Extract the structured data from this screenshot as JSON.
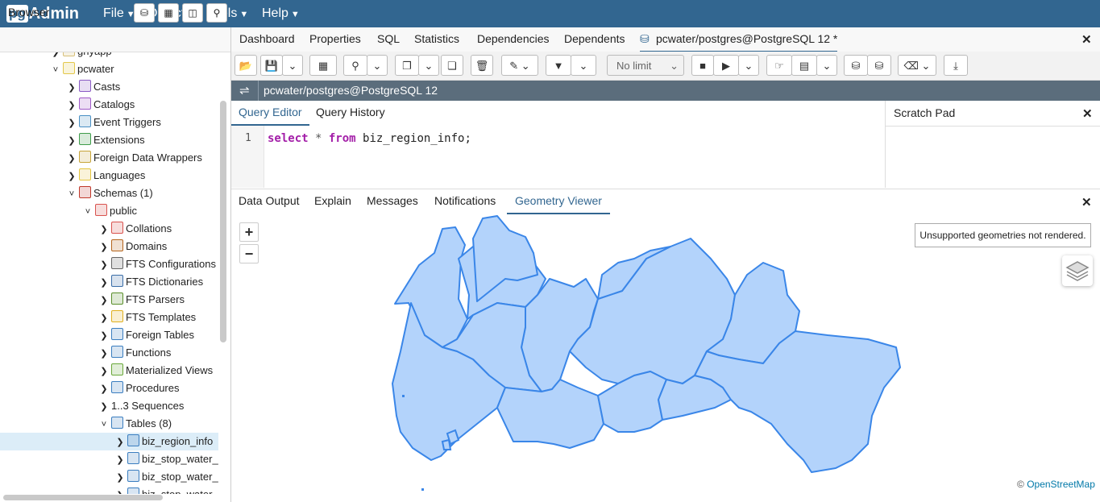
{
  "app": {
    "logo_pg": "pg",
    "logo_admin": "Admin"
  },
  "menu": [
    {
      "label": "File"
    },
    {
      "label": "Object"
    },
    {
      "label": "Tools"
    },
    {
      "label": "Help"
    }
  ],
  "browser": {
    "title": "Browser",
    "tree": [
      {
        "label": "gnyapp",
        "level": 3,
        "arrow": "›",
        "icon_color": "#d7c07a"
      },
      {
        "label": "pcwater",
        "level": 3,
        "arrow": "⌄",
        "icon_color": "#e3c84b"
      },
      {
        "label": "Casts",
        "level": 4,
        "arrow": "›",
        "icon_color": "#8a5cc4"
      },
      {
        "label": "Catalogs",
        "level": 4,
        "arrow": "›",
        "icon_color": "#a05bc8"
      },
      {
        "label": "Event Triggers",
        "level": 4,
        "arrow": "›",
        "icon_color": "#4a90c4"
      },
      {
        "label": "Extensions",
        "level": 4,
        "arrow": "›",
        "icon_color": "#3f9c4a"
      },
      {
        "label": "Foreign Data Wrappers",
        "level": 4,
        "arrow": "›",
        "icon_color": "#c7a53a"
      },
      {
        "label": "Languages",
        "level": 4,
        "arrow": "›",
        "icon_color": "#e4c540"
      },
      {
        "label": "Schemas (1)",
        "level": 4,
        "arrow": "⌄",
        "icon_color": "#c0392b"
      },
      {
        "label": "public",
        "level": 5,
        "arrow": "⌄",
        "icon_color": "#d9534f"
      },
      {
        "label": "Collations",
        "level": 6,
        "arrow": "›",
        "icon_color": "#d9534f"
      },
      {
        "label": "Domains",
        "level": 6,
        "arrow": "›",
        "icon_color": "#b5651d"
      },
      {
        "label": "FTS Configurations",
        "level": 6,
        "arrow": "›",
        "icon_color": "#666666"
      },
      {
        "label": "FTS Dictionaries",
        "level": 6,
        "arrow": "›",
        "icon_color": "#3b6ea8"
      },
      {
        "label": "FTS Parsers",
        "level": 6,
        "arrow": "›",
        "icon_color": "#5a8f2c"
      },
      {
        "label": "FTS Templates",
        "level": 6,
        "arrow": "›",
        "icon_color": "#e0b020"
      },
      {
        "label": "Foreign Tables",
        "level": 6,
        "arrow": "›",
        "icon_color": "#3b7ec0"
      },
      {
        "label": "Functions",
        "level": 6,
        "arrow": "›",
        "icon_color": "#3b7ec0"
      },
      {
        "label": "Materialized Views",
        "level": 6,
        "arrow": "›",
        "icon_color": "#6aa83a"
      },
      {
        "label": "Procedures",
        "level": 6,
        "arrow": "›",
        "icon_color": "#3b7ec0"
      },
      {
        "label": "1..3 Sequences",
        "level": 6,
        "arrow": "›",
        "icon_color": ""
      },
      {
        "label": "Tables (8)",
        "level": 6,
        "arrow": "⌄",
        "icon_color": "#3b7ec0"
      },
      {
        "label": "biz_region_info",
        "level": 7,
        "arrow": "›",
        "icon_color": "#3b7ec0",
        "selected": true
      },
      {
        "label": "biz_stop_water_",
        "level": 7,
        "arrow": "›",
        "icon_color": "#3b7ec0"
      },
      {
        "label": "biz_stop_water_",
        "level": 7,
        "arrow": "›",
        "icon_color": "#3b7ec0"
      },
      {
        "label": "biz_stop_water",
        "level": 7,
        "arrow": "›",
        "icon_color": "#3b7ec0"
      }
    ]
  },
  "tabs": [
    {
      "label": "Dashboard"
    },
    {
      "label": "Properties"
    },
    {
      "label": "SQL"
    },
    {
      "label": "Statistics"
    },
    {
      "label": "Dependencies"
    },
    {
      "label": "Dependents"
    },
    {
      "label": "pcwater/postgres@PostgreSQL 12 *",
      "active": true
    }
  ],
  "toolbar": {
    "limit": "No limit"
  },
  "connection": {
    "title": "pcwater/postgres@PostgreSQL 12"
  },
  "editor": {
    "tabs": [
      {
        "label": "Query Editor",
        "active": true
      },
      {
        "label": "Query History"
      }
    ],
    "scratch_title": "Scratch Pad",
    "line_number": "1",
    "code_kw1": "select",
    "code_mid": " * ",
    "code_kw2": "from",
    "code_rest": " biz_region_info;"
  },
  "output": {
    "tabs": [
      {
        "label": "Data Output"
      },
      {
        "label": "Explain"
      },
      {
        "label": "Messages"
      },
      {
        "label": "Notifications"
      },
      {
        "label": "Geometry Viewer",
        "active": true
      }
    ],
    "zoom_in": "+",
    "zoom_out": "−",
    "unsupported": "Unsupported geometries not rendered.",
    "attribution_prefix": "©",
    "attribution_link": "OpenStreetMap"
  },
  "colors": {
    "nav": "#326690",
    "accent": "#326690",
    "region_fill": "#b3d3fb",
    "region_stroke": "#3a86e8"
  }
}
